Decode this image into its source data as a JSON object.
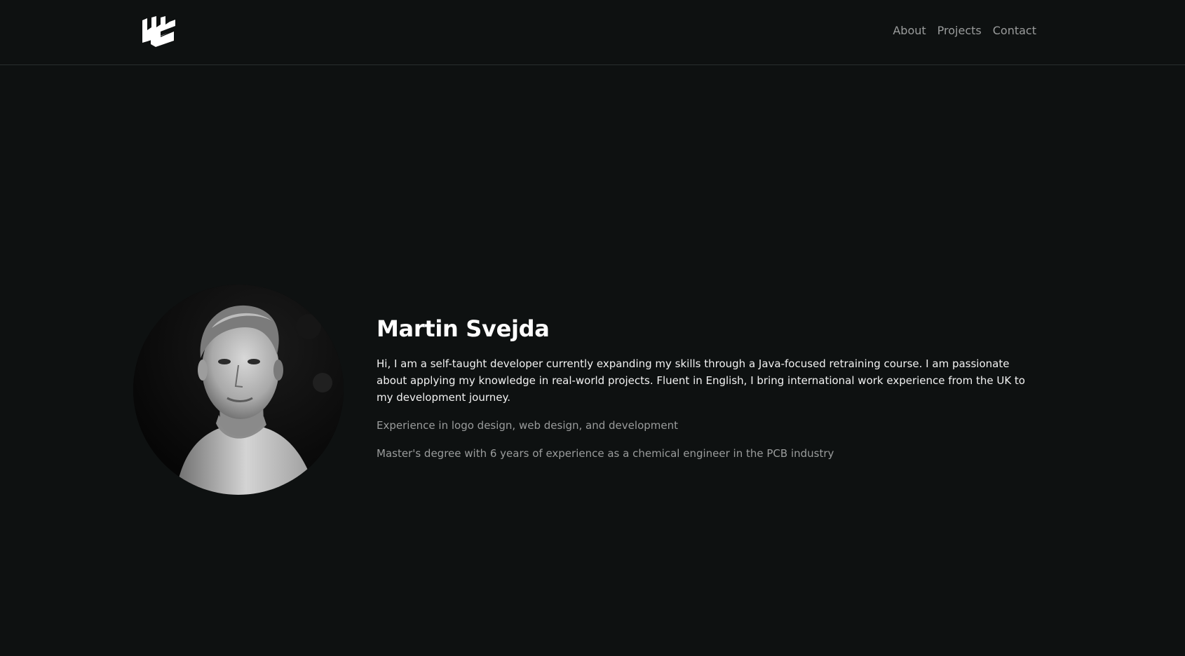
{
  "header": {
    "logo_icon": "ms-monogram-logo",
    "nav": [
      {
        "label": "About"
      },
      {
        "label": "Projects"
      },
      {
        "label": "Contact"
      }
    ]
  },
  "hero": {
    "avatar_icon": "profile-photo",
    "name": "Martin Svejda",
    "bio": "Hi, I am a self-taught developer currently expanding my skills through a Java-focused retraining course. I am passionate about applying my knowledge in real-world projects. Fluent in English, I bring international work experience from the UK to my development journey.",
    "details": [
      "Experience in logo design, web design, and development",
      "Master's degree with 6 years of experience as a chemical engineer in the PCB industry"
    ]
  },
  "colors": {
    "background": "#0e1111",
    "divider": "#2a2e2e",
    "heading": "#ffffff",
    "body_text": "#f2f2f2",
    "muted_text": "#9a9c9c"
  }
}
